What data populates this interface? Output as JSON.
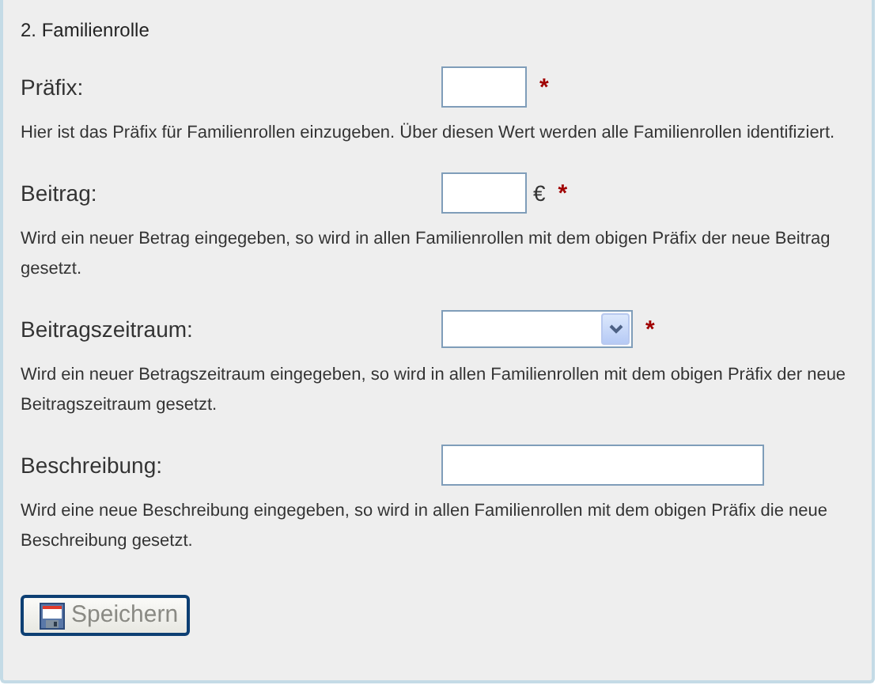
{
  "section_title": "2. Familienrolle",
  "fields": [
    {
      "kind": "short_text",
      "label": "Präfix:",
      "required_marker": "*",
      "help": "Hier ist das Präfix für Familienrollen einzugeben. Über diesen Wert werden alle Familienrollen identifiziert."
    },
    {
      "kind": "short_text",
      "label": "Beitrag:",
      "suffix": "€",
      "required_marker": "*",
      "help": "Wird ein neuer Betrag eingegeben, so wird in allen Familienrollen mit dem obigen Präfix der neue Beitrag gesetzt."
    },
    {
      "kind": "select",
      "label": "Beitragszeitraum:",
      "required_marker": "*",
      "help": "Wird ein neuer Betragszeitraum eingegeben, so wird in allen Familienrollen mit dem obigen Präfix der neue Beitragszeitraum gesetzt."
    },
    {
      "kind": "long_text",
      "label": "Beschreibung:",
      "help": "Wird eine neue Beschreibung eingegeben, so wird in allen Familienrollen mit dem obigen Präfix die neue Beschreibung gesetzt."
    }
  ],
  "save_button": {
    "label": "Speichern",
    "disabled": true
  }
}
